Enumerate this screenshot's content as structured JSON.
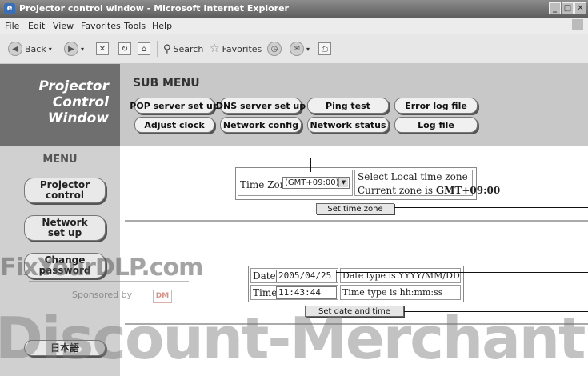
{
  "window": {
    "title": "Projector control window - Microsoft Internet Explorer",
    "controls": [
      "minimize-icon",
      "maximize-icon",
      "close-icon"
    ]
  },
  "browser_menu": [
    "File",
    "Edit",
    "View",
    "Favorites",
    "Tools",
    "Help"
  ],
  "toolbar": {
    "back_label": "Back",
    "search_label": "Search",
    "favorites_label": "Favorites"
  },
  "logo": [
    "Projector",
    "Control",
    "Window"
  ],
  "submenu": {
    "title": "SUB MENU",
    "buttons": [
      "POP server set up",
      "DNS server set up",
      "Ping test",
      "Error log file",
      "Adjust clock",
      "Network config",
      "Network status",
      "Log file"
    ]
  },
  "menu": {
    "title": "MENU",
    "projector_control": [
      "Projector",
      "control"
    ],
    "network_setup": [
      "Network",
      "set up"
    ],
    "change_password": [
      "Change",
      "password"
    ],
    "language": "日本語"
  },
  "timezone": {
    "label": "Time Zone",
    "selected": "(GMT+09:00)",
    "hint": "Select Local time zone",
    "current_prefix": "Current zone is ",
    "current_value": "GMT+09:00",
    "button": "Set time zone"
  },
  "datetime": {
    "date_label": "Date",
    "date_value": "2005/04/25",
    "date_hint": "Date type is YYYY/MM/DD",
    "time_label": "Time",
    "time_value": "11:43:44",
    "time_hint": "Time type is hh:mm:ss",
    "button": "Set date and time"
  },
  "watermark": {
    "site": "FixYourDLP.com",
    "sponsored": "Sponsored by",
    "sponsor_logo": "DM",
    "banner": "Discount-Merchant.com"
  }
}
